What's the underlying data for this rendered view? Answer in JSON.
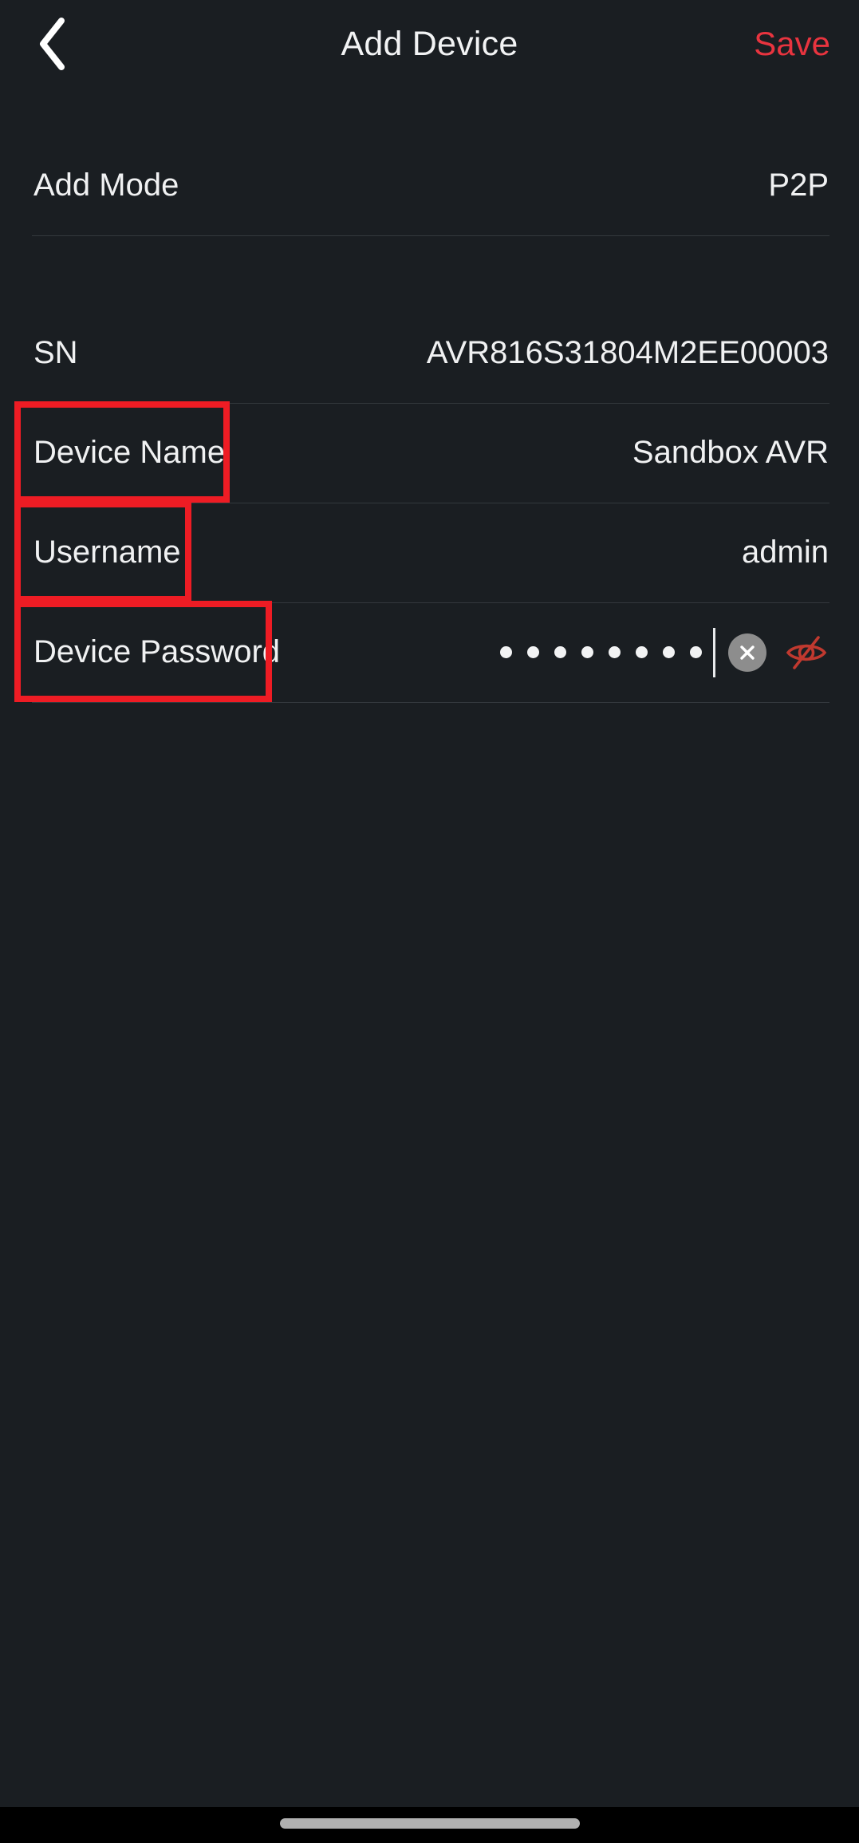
{
  "header": {
    "back_icon": "chevron-left-icon",
    "title": "Add Device",
    "save_label": "Save"
  },
  "accent_colors": {
    "save_red": "#e8343f",
    "annotation_red": "#ee1c24",
    "eye_icon_red": "#c0392f",
    "background": "#1a1e22",
    "separator": "#33383d",
    "text_primary": "#f0f1f2",
    "clear_button_gray": "#8d8d8d",
    "home_indicator_gray": "#b0b0b0"
  },
  "sections": {
    "mode": {
      "row": {
        "label": "Add Mode",
        "value": "P2P"
      }
    },
    "form": {
      "rows": [
        {
          "label": "SN",
          "value": "AVR816S31804M2EE00003"
        },
        {
          "label": "Device Name",
          "value": "Sandbox AVR"
        },
        {
          "label": "Username",
          "value": "admin"
        }
      ],
      "password_row": {
        "label": "Device Password",
        "masked_char_count": 8,
        "clear_icon": "close-circle-icon",
        "visibility_icon": "eye-off-icon"
      }
    }
  },
  "annotations": {
    "highlighted_labels": [
      "Device Name",
      "Username",
      "Device Password"
    ]
  },
  "system": {
    "home_indicator": "home-indicator"
  }
}
